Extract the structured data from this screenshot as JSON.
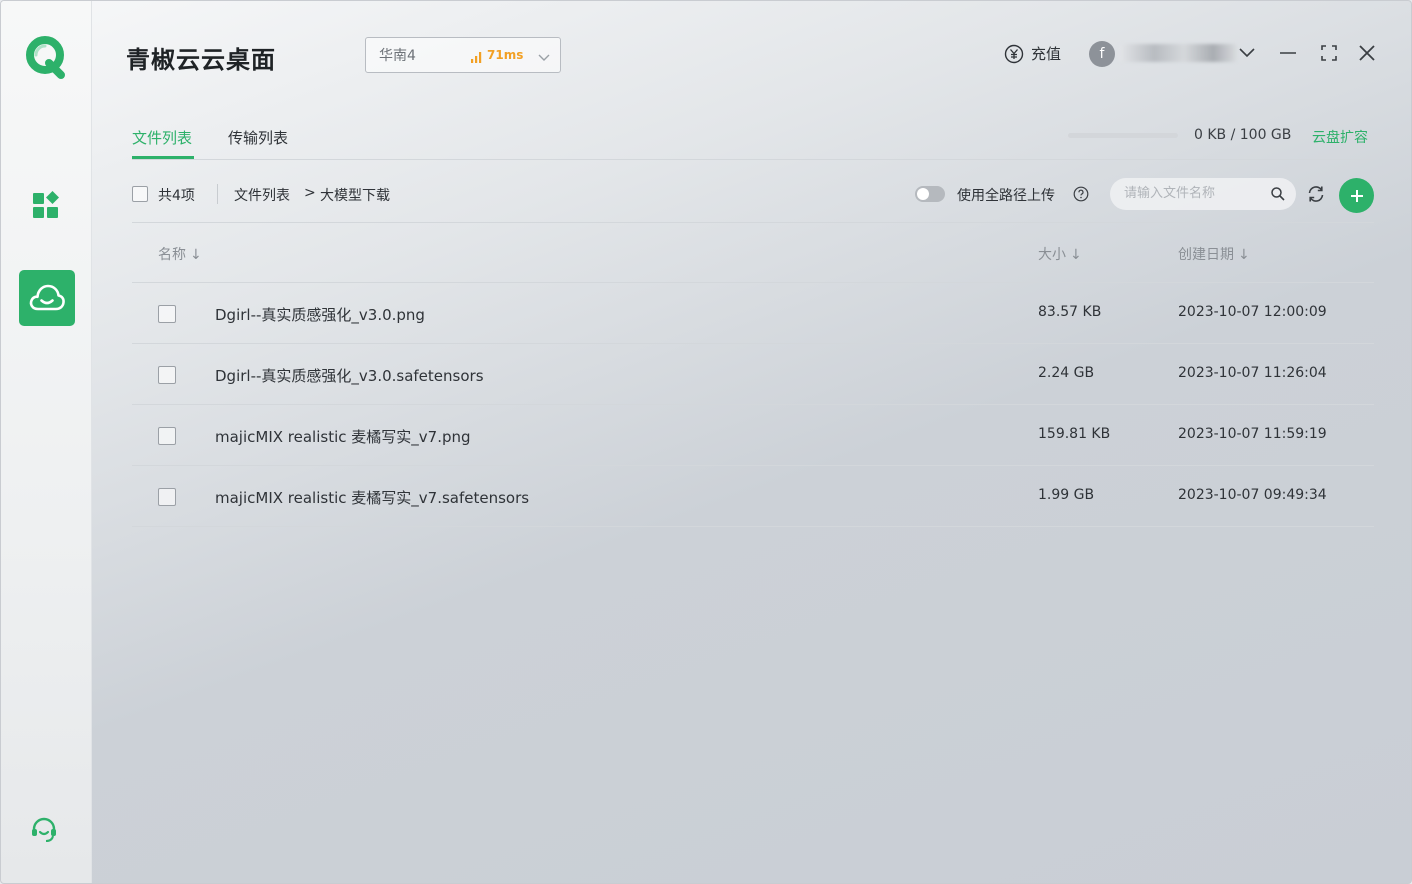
{
  "app": {
    "title": "青椒云云桌面",
    "brand_color": "#2db16a"
  },
  "region": {
    "name": "华南4",
    "latency": "71ms",
    "latency_color": "#f2a024"
  },
  "header": {
    "recharge_label": "充值",
    "avatar_letter": "f"
  },
  "tabs": [
    {
      "label": "文件列表",
      "active": true
    },
    {
      "label": "传输列表",
      "active": false
    }
  ],
  "storage": {
    "used_fraction": 0,
    "text": "0 KB / 100 GB",
    "expand_label": "云盘扩容"
  },
  "toolbar": {
    "count_label": "共4项",
    "breadcrumb": [
      "文件列表",
      ">",
      "大模型下载"
    ],
    "full_path_label": "使用全路径上传",
    "full_path_enabled": false,
    "search_placeholder": "请输入文件名称"
  },
  "table": {
    "columns": [
      "名称",
      "大小",
      "创建日期"
    ],
    "sort_arrow": "↓",
    "rows": [
      {
        "name": "Dgirl--真实质感强化_v3.0.png",
        "size": "83.57 KB",
        "date": "2023-10-07 12:00:09"
      },
      {
        "name": "Dgirl--真实质感强化_v3.0.safetensors",
        "size": "2.24 GB",
        "date": "2023-10-07 11:26:04"
      },
      {
        "name": "majicMIX realistic 麦橘写实_v7.png",
        "size": "159.81 KB",
        "date": "2023-10-07 11:59:19"
      },
      {
        "name": "majicMIX realistic 麦橘写实_v7.safetensors",
        "size": "1.99 GB",
        "date": "2023-10-07 09:49:34"
      }
    ]
  }
}
